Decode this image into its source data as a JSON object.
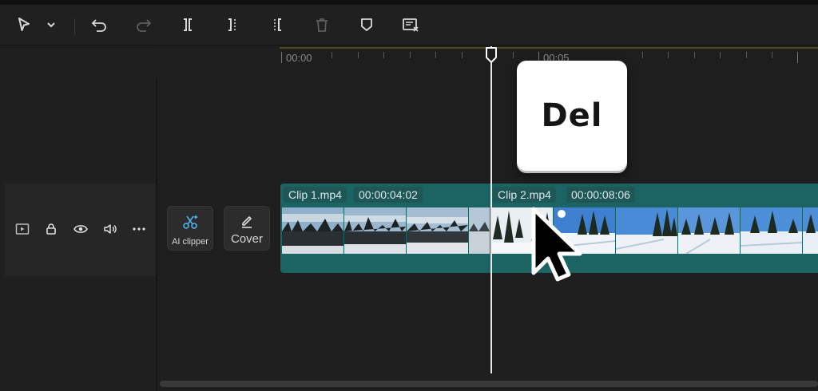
{
  "toolbar": {
    "tools": [
      "select-icon",
      "dropdown-icon",
      "undo-icon",
      "redo-icon",
      "split-icon",
      "split-left-icon",
      "split-right-icon",
      "delete-icon",
      "marker-icon",
      "auto-cut-icon"
    ]
  },
  "timeline": {
    "ruler": {
      "start_label": "00:00",
      "mark_label": "00:05"
    },
    "clips": [
      {
        "name": "Clip 1.mp4",
        "duration": "00:00:04:02"
      },
      {
        "name": "Clip 2.mp4",
        "duration": "00:00:08:06"
      }
    ]
  },
  "track_controls": {
    "icons": [
      "video-track-icon",
      "lock-icon",
      "eye-icon",
      "audio-icon",
      "more-icon"
    ]
  },
  "side_buttons": {
    "ai_clipper_label": "AI clipper",
    "cover_label": "Cover"
  },
  "overlay": {
    "key_label": "Del"
  },
  "colors": {
    "background": "#1e1e1e",
    "track_teal": "#1c6464",
    "playhead": "#e8e8e8",
    "ruler_accent": "#4a4a20"
  }
}
